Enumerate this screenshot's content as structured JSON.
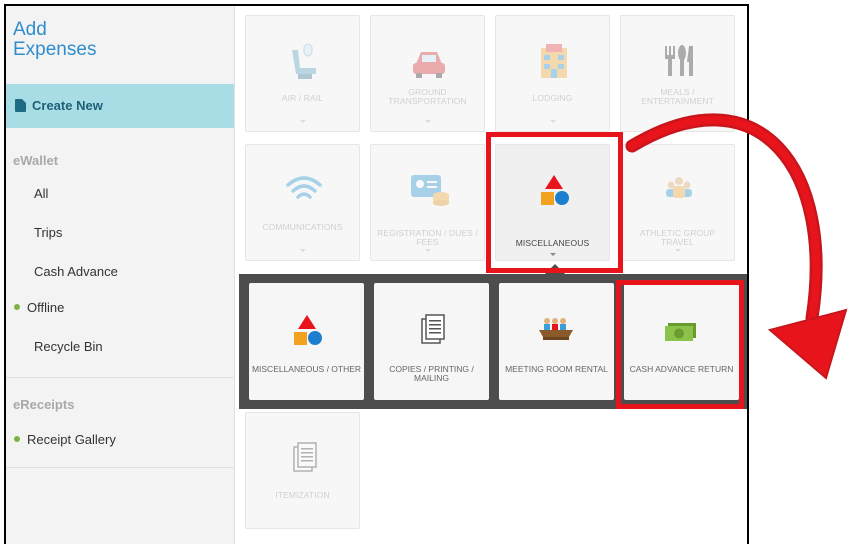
{
  "sidebar": {
    "title_line1": "Add",
    "title_line2": "Expenses",
    "create_new": "Create New",
    "ewallet_label": "eWallet",
    "ewallet_items": [
      "All",
      "Trips",
      "Cash Advance",
      "Offline",
      "Recycle Bin"
    ],
    "ereceipts_label": "eReceipts",
    "ereceipts_items": [
      "Receipt Gallery"
    ]
  },
  "categories": [
    {
      "label": "AIR / RAIL",
      "icon": "seat-icon"
    },
    {
      "label": "GROUND TRANSPORTATION",
      "icon": "car-icon"
    },
    {
      "label": "LODGING",
      "icon": "hotel-icon"
    },
    {
      "label": "MEALS / ENTERTAINMENT",
      "icon": "utensils-icon"
    },
    {
      "label": "COMMUNICATIONS",
      "icon": "wifi-icon"
    },
    {
      "label": "REGISTRATION / DUES / FEES",
      "icon": "id-card-icon"
    },
    {
      "label": "MISCELLANEOUS",
      "icon": "shapes-icon"
    },
    {
      "label": "ATHLETIC GROUP TRAVEL",
      "icon": "group-icon"
    }
  ],
  "subcategories": [
    {
      "label": "MISCELLANEOUS / OTHER",
      "icon": "shapes-icon"
    },
    {
      "label": "COPIES / PRINTING / MAILING",
      "icon": "documents-icon"
    },
    {
      "label": "MEETING ROOM RENTAL",
      "icon": "meeting-icon"
    },
    {
      "label": "CASH ADVANCE RETURN",
      "icon": "cash-icon"
    }
  ],
  "extra": [
    {
      "label": "ITEMIZATION",
      "icon": "documents-icon"
    }
  ],
  "colors": {
    "accent": "#2f8dcc",
    "highlight": "#e8141c",
    "active_bg": "#a9dde5",
    "panel_bg": "#4d4d4d",
    "online_dot": "#7cb342"
  }
}
